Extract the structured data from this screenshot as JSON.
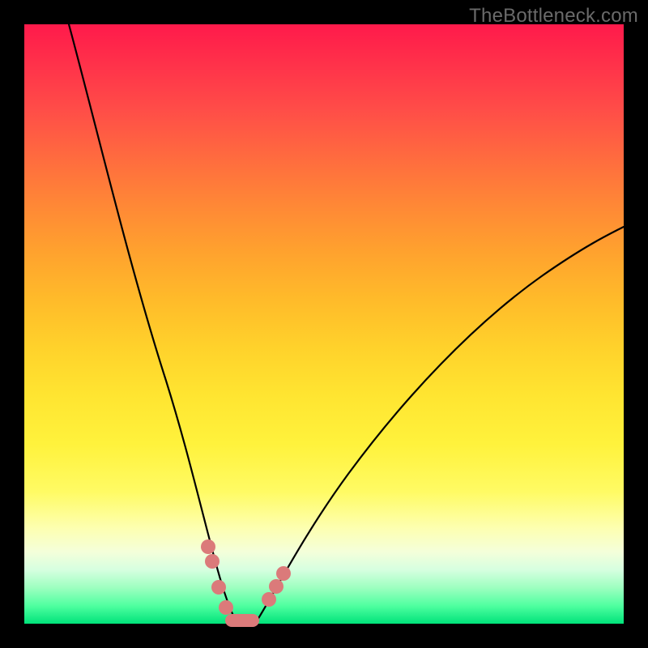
{
  "watermark_text": "TheBottleneck.com",
  "colors": {
    "frame": "#000000",
    "curve": "#000000",
    "marker": "#db7a7a",
    "gradient_top": "#ff1a4b",
    "gradient_bottom": "#00e37a"
  },
  "chart_data": {
    "type": "line",
    "title": "",
    "xlabel": "",
    "ylabel": "",
    "xlim": [
      0,
      100
    ],
    "ylim": [
      0,
      100
    ],
    "x": [
      0,
      5,
      10,
      15,
      20,
      25,
      30,
      33,
      35,
      37,
      40,
      45,
      50,
      60,
      70,
      80,
      90,
      100
    ],
    "values": [
      100,
      88,
      75,
      60,
      44,
      27,
      10,
      3,
      0,
      0,
      2,
      8,
      16,
      30,
      42,
      52,
      60,
      66
    ],
    "markers": {
      "left_cluster_x": [
        28,
        29,
        30,
        32
      ],
      "left_cluster_y": [
        13,
        11,
        6,
        1
      ],
      "pill": {
        "x_start": 32,
        "x_end": 37,
        "y": 0
      },
      "right_cluster_x": [
        40,
        41,
        42
      ],
      "right_cluster_y": [
        4,
        6,
        8
      ]
    },
    "legend": "none",
    "grid": false
  }
}
